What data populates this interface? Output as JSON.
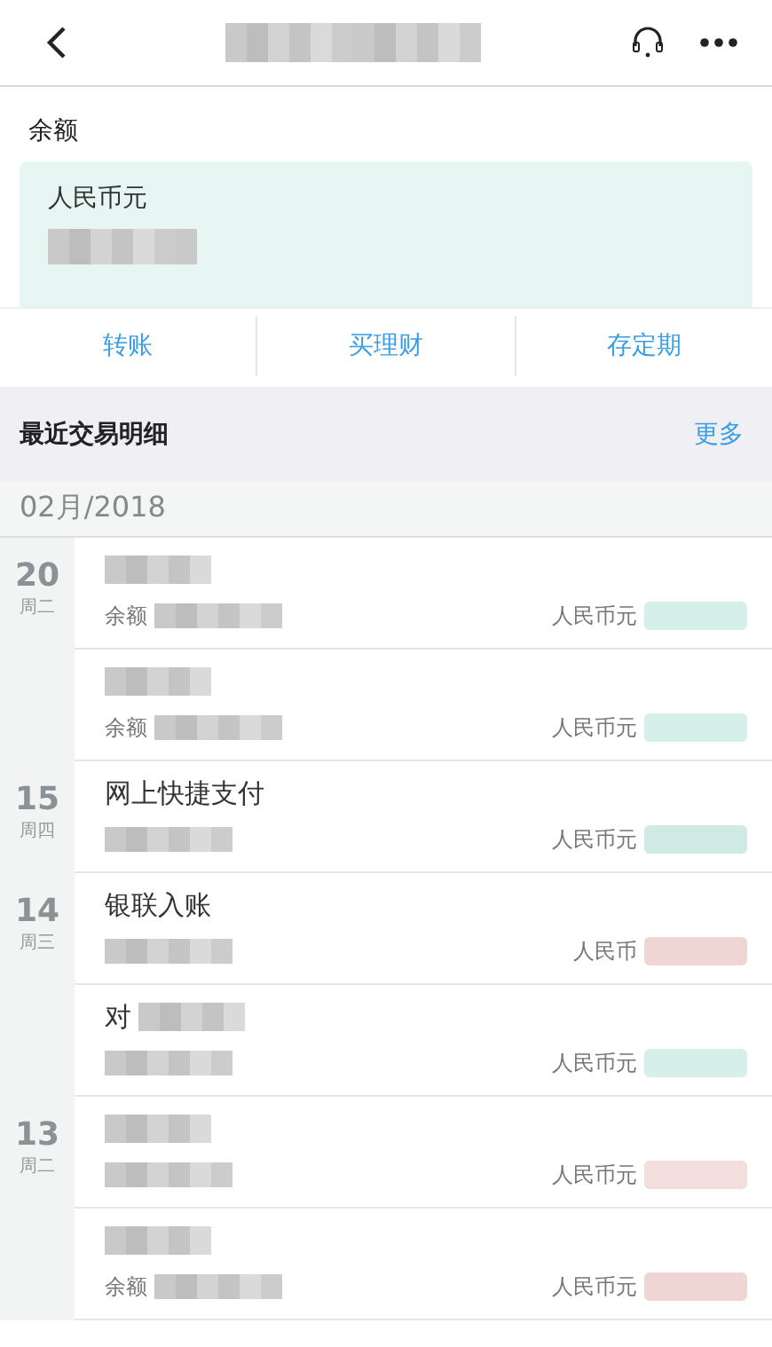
{
  "header": {
    "title_redacted": true
  },
  "balance": {
    "label": "余额",
    "currency": "人民币元",
    "amount_redacted": true
  },
  "actions": [
    "转账",
    "买理财",
    "存定期"
  ],
  "section": {
    "title": "最近交易明细",
    "more": "更多"
  },
  "month": "02月/2018",
  "rows": [
    {
      "day": "20",
      "weekday": "周二",
      "title_redacted": true,
      "sub": "余额",
      "sub_redacted": true,
      "currency": "人民币元",
      "color": "#d6efe8"
    },
    {
      "title_redacted": true,
      "sub": "余额",
      "sub_redacted": true,
      "currency": "人民币元",
      "color": "#d6efe8"
    },
    {
      "day": "15",
      "weekday": "周四",
      "title": "网上快捷支付",
      "sub_redacted": true,
      "currency": "人民币元",
      "color": "#cfeae2"
    },
    {
      "day": "14",
      "weekday": "周三",
      "title": "银联入账",
      "sub_redacted": true,
      "currency": "人民币",
      "color": "#f0d5d5"
    },
    {
      "title": "对",
      "title_redacted": true,
      "sub_redacted": true,
      "currency": "人民币元",
      "color": "#d6efe8"
    },
    {
      "day": "13",
      "weekday": "周二",
      "title_redacted": true,
      "sub_redacted": true,
      "currency": "人民币元",
      "color": "#f3dede"
    },
    {
      "title_redacted": true,
      "sub": "余额",
      "sub_redacted": true,
      "currency": "人民币元",
      "color": "#f0d5d5"
    }
  ]
}
